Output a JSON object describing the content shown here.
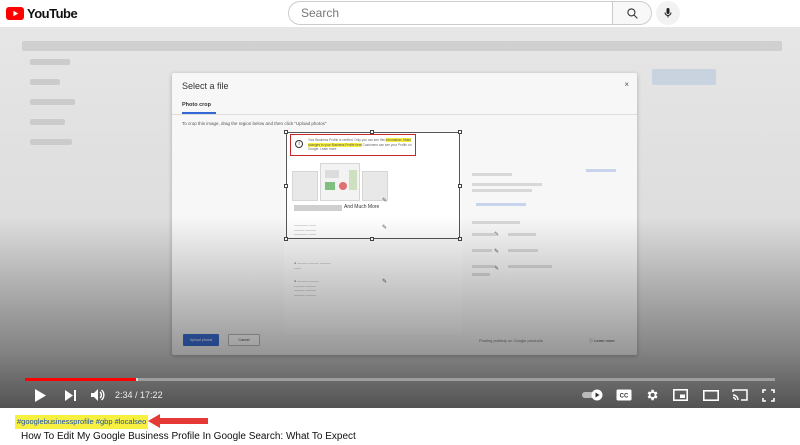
{
  "header": {
    "logo_text": "YouTube",
    "search_placeholder": "Search",
    "icons": [
      "youtube-logo-icon",
      "search-icon",
      "microphone-icon"
    ]
  },
  "dialog": {
    "title": "Select a file",
    "close": "×",
    "tab": "Photo crop",
    "instruction": "To crop this image, drag the region below and then click \"Upload photos\"",
    "highlight_plain": "Your Business Profile is verified. Only you can see this ",
    "highlight_marked": "information. Make changes to your Business Profile here",
    "highlight_rest": " Customers can see your Profile on Google. Learn more",
    "business_name": "And Much More",
    "upload_button": "Upload photos",
    "cancel_button": "Cancel",
    "footer_text": "Posting publicly on Google products",
    "learn_more": "Learn more"
  },
  "player": {
    "time_current": "2:34",
    "time_total": "17:22",
    "progress_fraction": 0.1475,
    "loaded_fraction": 0.15,
    "controls": [
      "play-icon",
      "next-icon",
      "volume-icon",
      "autoplay-toggle",
      "subtitles-icon",
      "settings-icon",
      "miniplayer-icon",
      "theater-icon",
      "cast-icon",
      "fullscreen-icon"
    ],
    "accent_color": "#ff0000"
  },
  "video": {
    "hashtags": "#googlebusinessprofile #gbp #localseo",
    "title": "How To Edit My Google Business Profile In Google Search: What To Expect"
  }
}
